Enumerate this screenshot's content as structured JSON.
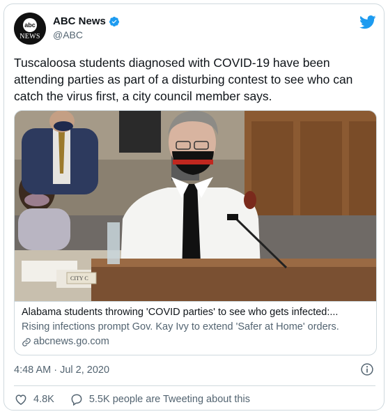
{
  "account": {
    "name": "ABC News",
    "handle": "@ABC",
    "avatar_text_top": "abc",
    "avatar_text_bottom": "NEWS"
  },
  "tweet": {
    "text": "Tuscaloosa students diagnosed with COVID-19 have been attending parties as part of a disturbing contest to see who can catch the virus first, a city council member says.",
    "timestamp": "4:48 AM · Jul 2, 2020"
  },
  "card": {
    "title": "Alabama students throwing 'COVID parties' to see who gets infected:...",
    "description": "Rising infections prompt Gov. Kay Ivy to extend 'Safer at Home' orders.",
    "domain": "abcnews.go.com",
    "image_label": "CITY C"
  },
  "actions": {
    "likes": "4.8K",
    "tweeting": "5.5K people are Tweeting about this"
  },
  "colors": {
    "twitter_blue": "#1d9bf0",
    "secondary_text": "#536471",
    "border": "#cfd9de"
  }
}
